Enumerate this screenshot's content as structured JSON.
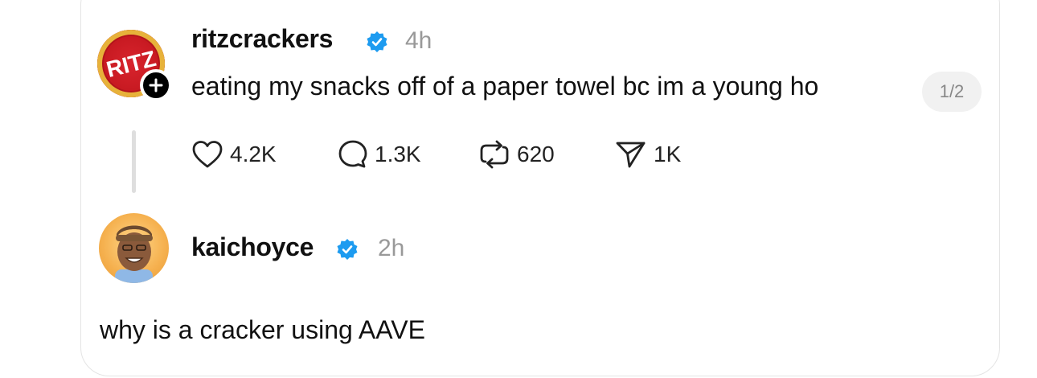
{
  "post": {
    "username": "ritzcrackers",
    "time": "4h",
    "text": "eating my snacks off of a paper towel bc im a young ho",
    "page_indicator": "1/2",
    "avatar_text": "RITZ",
    "follow_symbol": "+",
    "actions": {
      "likes": "4.2K",
      "comments": "1.3K",
      "reposts": "620",
      "shares": "1K"
    }
  },
  "reply": {
    "username": "kaichoyce",
    "time": "2h",
    "text": "why is a cracker using AAVE"
  },
  "colors": {
    "verified": "#1d9bf0",
    "ritz_red": "#c81a22",
    "ritz_gold": "#e7b23a",
    "muted_text": "#999999"
  },
  "icons": [
    "verified-badge-icon",
    "plus-icon",
    "heart-icon",
    "comment-icon",
    "repost-icon",
    "share-icon"
  ]
}
